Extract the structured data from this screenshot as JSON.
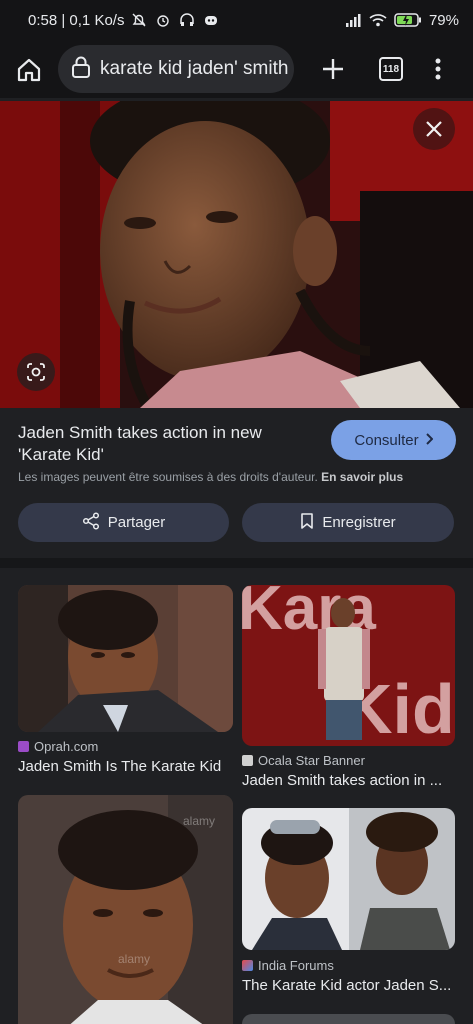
{
  "status_bar": {
    "time_speed": "0:58 | 0,1 Ko/s",
    "battery": "79%"
  },
  "toolbar": {
    "query": "karate kid jaden' smith",
    "tab_count": "118"
  },
  "detail": {
    "title": "Jaden Smith takes action in new 'Karate Kid'",
    "visit_label": "Consulter",
    "copyright_text": "Les images peuvent être soumises à des droits d'auteur.",
    "learn_more": "En savoir plus",
    "share_label": "Partager",
    "save_label": "Enregistrer"
  },
  "results": [
    {
      "source": "Oprah.com",
      "caption": "Jaden Smith Is The Karate Kid"
    },
    {
      "source": "Ocala Star Banner",
      "caption": "Jaden Smith takes action in ..."
    },
    {
      "source": "India Forums",
      "caption": "The Karate Kid actor Jaden S..."
    }
  ],
  "poster_text": {
    "word_top": "Kara",
    "word_bottom": "Kid"
  },
  "watermark": "alamy",
  "colors": {
    "accent_button": "#7ba1e6",
    "pill_bg": "#34394a",
    "background": "#1f2023"
  },
  "icons": [
    "home-icon",
    "lock-icon",
    "plus-icon",
    "more-icon",
    "close-icon",
    "lens-icon",
    "share-icon",
    "bookmark-icon",
    "chevron-right-icon"
  ]
}
